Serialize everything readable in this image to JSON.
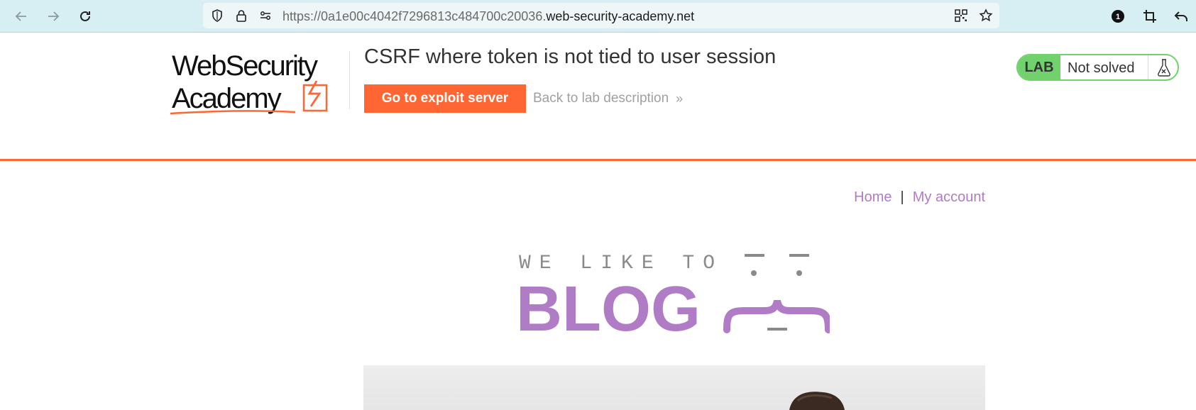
{
  "browser": {
    "url_prefix": "https://0a1e00c4042f7296813c484700c20036.",
    "url_domain": "web-security-academy.net",
    "extensions_badge": "1",
    "icons": {
      "back": "back-arrow-icon",
      "forward": "forward-arrow-icon",
      "reload": "reload-icon",
      "tracking": "shield-icon",
      "secure": "lock-icon",
      "permissions": "permissions-icon",
      "qr": "qr-code-icon",
      "bookmark": "star-icon",
      "extension": "extension-badge-icon",
      "screenshot": "crop-icon",
      "menu": "undo-arrow-icon"
    }
  },
  "lab_header": {
    "logo_line1": "WebSecurity",
    "logo_line2": "Academy",
    "title": "CSRF where token is not tied to user session",
    "exploit_button": "Go to exploit server",
    "back_link": "Back to lab description",
    "back_link_chevron": "»",
    "lab_badge": "LAB",
    "lab_status": "Not solved",
    "lab_status_icon": "flask-icon"
  },
  "blog": {
    "nav": {
      "home": "Home",
      "separator": "|",
      "my_account": "My account"
    },
    "banner_line1": "WE LIKE TO",
    "banner_line2": "BLOG"
  },
  "colors": {
    "accent_orange": "#ff6633",
    "lab_green": "#70d16d",
    "link_purple": "#b07cc6",
    "toolbar_bg": "#d7eef2"
  }
}
